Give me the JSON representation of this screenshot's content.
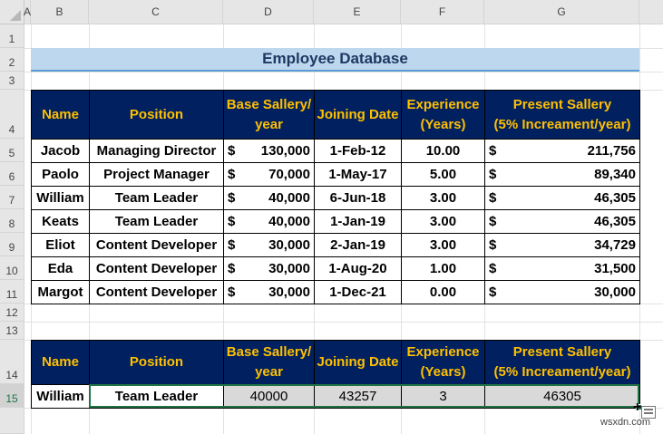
{
  "columns": [
    "A",
    "B",
    "C",
    "D",
    "E",
    "F",
    "G"
  ],
  "rows": [
    "1",
    "2",
    "3",
    "4",
    "5",
    "6",
    "7",
    "8",
    "9",
    "10",
    "11",
    "12",
    "13",
    "14",
    "15"
  ],
  "title": "Employee Database",
  "headers": {
    "name": "Name",
    "position": "Position",
    "base_1": "Base Sallery/",
    "base_2": "year",
    "joining": "Joining Date",
    "exp_1": "Experience",
    "exp_2": "(Years)",
    "present_1": "Present Sallery",
    "present_2": "(5% Increament/year)"
  },
  "currency": "$",
  "employees": [
    {
      "name": "Jacob",
      "position": "Managing Director",
      "base": "130,000",
      "joining": "1-Feb-12",
      "experience": "10.00",
      "present": "211,756"
    },
    {
      "name": "Paolo",
      "position": "Project Manager",
      "base": "70,000",
      "joining": "1-May-17",
      "experience": "5.00",
      "present": "89,340"
    },
    {
      "name": "William",
      "position": "Team Leader",
      "base": "40,000",
      "joining": "6-Jun-18",
      "experience": "3.00",
      "present": "46,305"
    },
    {
      "name": "Keats",
      "position": "Team Leader",
      "base": "40,000",
      "joining": "1-Jan-19",
      "experience": "3.00",
      "present": "46,305"
    },
    {
      "name": "Eliot",
      "position": "Content Developer",
      "base": "30,000",
      "joining": "2-Jan-19",
      "experience": "3.00",
      "present": "34,729"
    },
    {
      "name": "Eda",
      "position": "Content Developer",
      "base": "30,000",
      "joining": "1-Aug-20",
      "experience": "1.00",
      "present": "31,500"
    },
    {
      "name": "Margot",
      "position": "Content Developer",
      "base": "30,000",
      "joining": "1-Dec-21",
      "experience": "0.00",
      "present": "30,000"
    }
  ],
  "lookup": {
    "name": "William",
    "position": "Team Leader",
    "base": "40000",
    "joining": "43257",
    "experience": "3",
    "present": "46305"
  },
  "watermark": "wsxdn.com"
}
